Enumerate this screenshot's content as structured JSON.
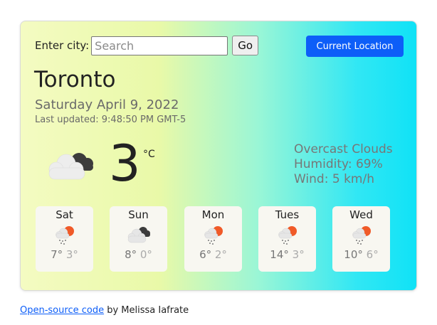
{
  "search": {
    "label": "Enter city:",
    "placeholder": "Search",
    "go_label": "Go"
  },
  "current_location_label": "Current Location",
  "weather": {
    "city": "Toronto",
    "date": "Saturday April 9, 2022",
    "last_updated": "Last updated: 9:48:50 PM GMT-5",
    "icon": "cloudy-icon",
    "temperature": "3",
    "unit": "°C",
    "description": "Overcast Clouds",
    "humidity": "Humidity: 69%",
    "wind": "Wind: 5 km/h"
  },
  "forecast": [
    {
      "day": "Sat",
      "icon": "rain-sun-icon",
      "high": "7°",
      "low": "3°"
    },
    {
      "day": "Sun",
      "icon": "cloudy-icon",
      "high": "8°",
      "low": "0°"
    },
    {
      "day": "Mon",
      "icon": "rain-sun-icon",
      "high": "6°",
      "low": "2°"
    },
    {
      "day": "Tues",
      "icon": "rain-sun-icon",
      "high": "14°",
      "low": "3°"
    },
    {
      "day": "Wed",
      "icon": "rain-sun-icon",
      "high": "10°",
      "low": "6°"
    }
  ],
  "footer": {
    "link_text": "Open-source code",
    "suffix": " by Melissa Iafrate"
  },
  "colors": {
    "accent": "#0d5ef8",
    "gradient_start": "#f4fbc2",
    "gradient_end": "#10e2f6"
  }
}
